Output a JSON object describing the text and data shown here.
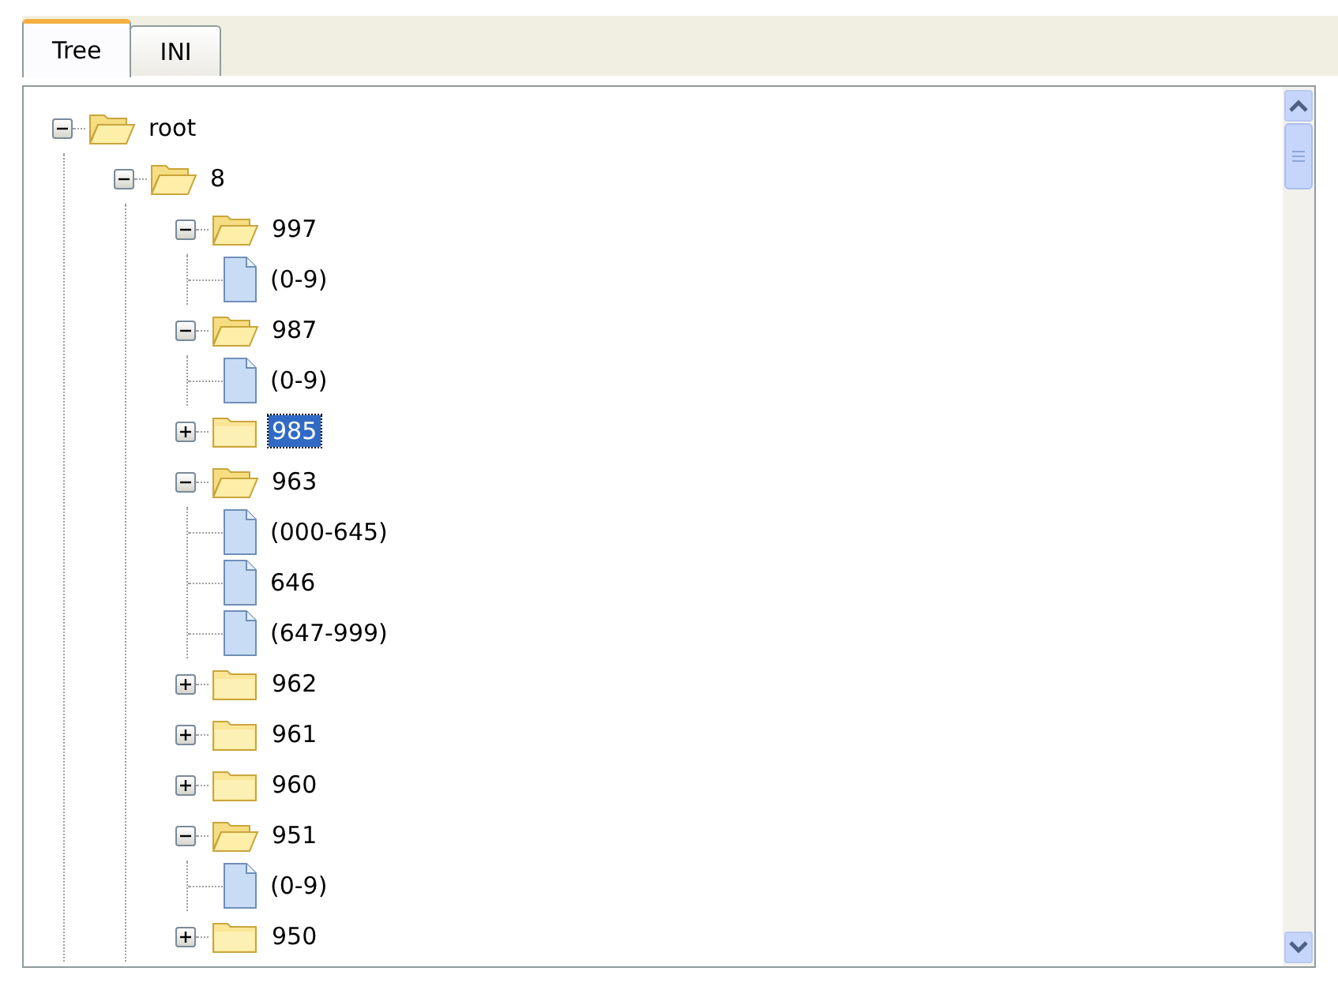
{
  "tabs": [
    {
      "label": "Tree",
      "selected": true
    },
    {
      "label": "INI",
      "selected": false
    }
  ],
  "tree": [
    {
      "kind": "folder",
      "label": "root",
      "expanded": true,
      "selected": false,
      "children": [
        {
          "kind": "folder",
          "label": "8",
          "expanded": true,
          "selected": false,
          "children": [
            {
              "kind": "folder",
              "label": "997",
              "expanded": true,
              "selected": false,
              "children": [
                {
                  "kind": "file",
                  "label": "(0-9)",
                  "selected": false
                }
              ]
            },
            {
              "kind": "folder",
              "label": "987",
              "expanded": true,
              "selected": false,
              "children": [
                {
                  "kind": "file",
                  "label": "(0-9)",
                  "selected": false
                }
              ]
            },
            {
              "kind": "folder",
              "label": "985",
              "expanded": false,
              "selected": true
            },
            {
              "kind": "folder",
              "label": "963",
              "expanded": true,
              "selected": false,
              "children": [
                {
                  "kind": "file",
                  "label": "(000-645)",
                  "selected": false
                },
                {
                  "kind": "file",
                  "label": "646",
                  "selected": false
                },
                {
                  "kind": "file",
                  "label": "(647-999)",
                  "selected": false
                }
              ]
            },
            {
              "kind": "folder",
              "label": "962",
              "expanded": false,
              "selected": false
            },
            {
              "kind": "folder",
              "label": "961",
              "expanded": false,
              "selected": false
            },
            {
              "kind": "folder",
              "label": "960",
              "expanded": false,
              "selected": false
            },
            {
              "kind": "folder",
              "label": "951",
              "expanded": true,
              "selected": false,
              "children": [
                {
                  "kind": "file",
                  "label": "(0-9)",
                  "selected": false
                }
              ]
            },
            {
              "kind": "folder",
              "label": "950",
              "expanded": false,
              "selected": false
            }
          ]
        }
      ]
    }
  ]
}
